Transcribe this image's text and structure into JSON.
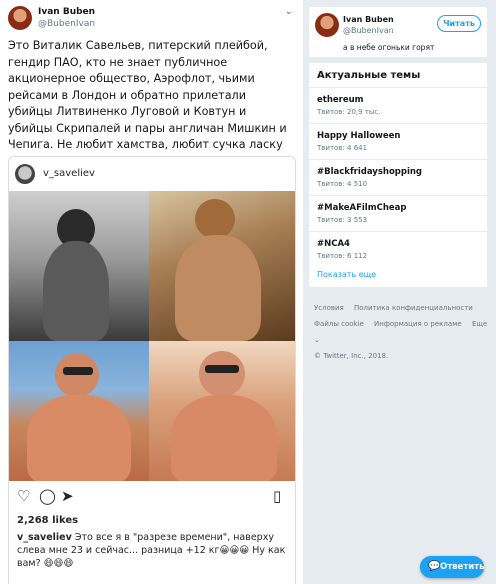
{
  "tweet": {
    "author_name": "Ivan Buben",
    "author_handle": "@BubenIvan",
    "text": "Это Виталик Савельев, питерский плейбой, гендир ПАО, кто не знает публичное акционерное общество, Аэрофлот, чьими рейсами в Лондон и обратно прилетали убийцы Литвиненко Луговой и Ковтун и убийцы Скрипалей и пары англичан Мишкин и Чепига. Не любит хамства, любит сучка ласку",
    "menu_icon": "chevron-down-icon"
  },
  "instagram": {
    "username": "v_saveliev",
    "likes": "2,268 likes",
    "caption_user": "v_saveliev",
    "caption_text": "Это все я в \"разрезе времени\", наверху слева мне 23 и сейчас... разница +12 кг😀😀😀 Ну как вам? 😄😄😄"
  },
  "profile_card": {
    "name": "Ivan Buben",
    "handle": "@BubenIvan",
    "follow_label": "Читать",
    "bio": "а в небе огоньки горят"
  },
  "trends": {
    "title": "Актуальные темы",
    "items": [
      {
        "name": "ethereum",
        "count": "Твитов: 20,9 тыс."
      },
      {
        "name": "Happy Halloween",
        "count": "Твитов: 4 641"
      },
      {
        "name": "#Blackfridayshopping",
        "count": "Твитов: 4 510"
      },
      {
        "name": "#MakeAFilmCheap",
        "count": "Твитов: 3 553"
      },
      {
        "name": "#NCA4",
        "count": "Твитов: 6 112"
      }
    ],
    "show_more": "Показать еще"
  },
  "footer": {
    "terms": "Условия",
    "privacy": "Политика конфиденциальности",
    "cookies": "Файлы cookie",
    "ads": "Информация о рекламе",
    "more": "Еще ⌄",
    "copyright": "© Twitter, Inc., 2018."
  },
  "reply_button": {
    "label": "Ответить"
  }
}
